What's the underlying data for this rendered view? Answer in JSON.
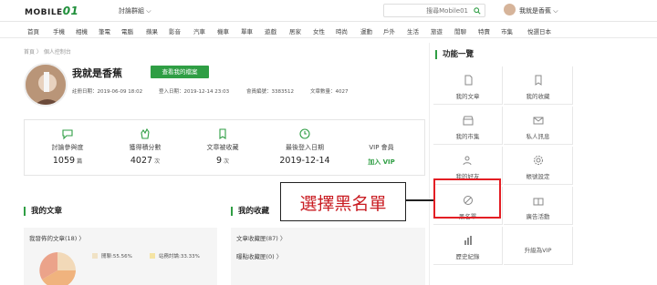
{
  "header": {
    "logo_text": "MOBILE",
    "logo_suffix": "01",
    "forum_menu": "討論群組",
    "search_placeholder": "搜尋Mobile01",
    "username": "我就是香蕉"
  },
  "nav": [
    "首頁",
    "手機",
    "相機",
    "筆電",
    "電腦",
    "蘋果",
    "影音",
    "汽車",
    "機車",
    "單車",
    "遊戲",
    "居家",
    "女性",
    "時尚",
    "運動",
    "戶外",
    "生活",
    "旅遊",
    "閒聊",
    "特賣",
    "市集",
    "悅選日本"
  ],
  "breadcrumb": "首頁 〉 個人控制台",
  "profile": {
    "name": "我就是香蕉",
    "file_button": "查看我的檔案",
    "reg_date": "註冊日期：2019-06-09 18:02",
    "login_time": "登入日期：2019-12-14 23:03",
    "member_id": "會員編號：3383512",
    "article_count": "文章數量：4027"
  },
  "stats": [
    {
      "label": "討論參與度",
      "value": "1059",
      "unit": "篇"
    },
    {
      "label": "獲得積分數",
      "value": "4027",
      "unit": "次"
    },
    {
      "label": "文章被收藏",
      "value": "9",
      "unit": "次"
    },
    {
      "label": "最後登入日期",
      "value": "2019-12-14",
      "unit": ""
    },
    {
      "label": "VIP 會員",
      "value": "",
      "unit": "",
      "link": "加入 VIP"
    }
  ],
  "my_articles": {
    "title": "我的文章",
    "line1": "我發佈的文章(18)",
    "legend1": "閒聊:55.56%",
    "legend2": "站務討論:33.33%"
  },
  "my_favorites": {
    "title": "我的收藏",
    "line1": "文章收藏匣(87)",
    "line2": "曝點收藏匣(0)"
  },
  "sidebar": {
    "title": "功能一覽",
    "items": [
      "我的文章",
      "我的收藏",
      "我的市集",
      "私人訊息",
      "我的好友",
      "帳號設定",
      "黑名單",
      "廣告活動",
      "歷史紀錄",
      "升級為VIP"
    ]
  },
  "callout": "選擇黑名單",
  "colors": {
    "accent": "#2f9e44",
    "highlight": "#e31e24",
    "callout_text": "#c91c22"
  }
}
